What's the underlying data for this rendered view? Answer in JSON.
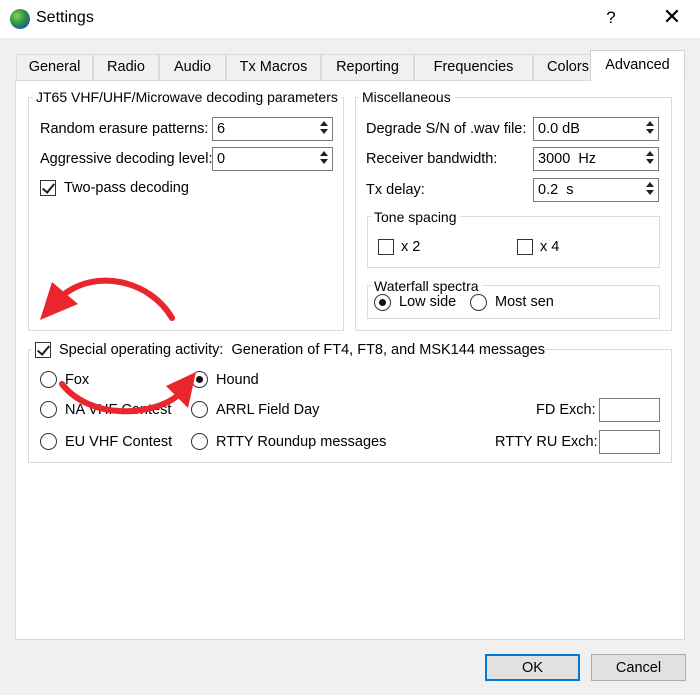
{
  "window": {
    "title": "Settings",
    "help": "?",
    "close": "✕"
  },
  "tabs": [
    {
      "label": "General"
    },
    {
      "label": "Radio"
    },
    {
      "label": "Audio"
    },
    {
      "label": "Tx Macros"
    },
    {
      "label": "Reporting"
    },
    {
      "label": "Frequencies"
    },
    {
      "label": "Colors"
    },
    {
      "label": "Advanced"
    }
  ],
  "jt65": {
    "title": "JT65 VHF/UHF/Microwave decoding parameters",
    "random_erasure": {
      "label": "Random erasure patterns:",
      "value": "6"
    },
    "aggressive": {
      "label": "Aggressive decoding level:",
      "value": "0"
    },
    "two_pass": {
      "label": "Two-pass decoding",
      "checked": true
    }
  },
  "misc": {
    "title": "Miscellaneous",
    "degrade": {
      "label": "Degrade S/N of .wav file:",
      "value": "0.0 dB"
    },
    "rx_bw": {
      "label": "Receiver bandwidth:",
      "value": "3000  Hz"
    },
    "tx_delay": {
      "label": "Tx delay:",
      "value": "0.2  s"
    },
    "tone_spacing": {
      "title": "Tone spacing",
      "x2": "x 2",
      "x4": "x 4"
    },
    "waterfall": {
      "title": "Waterfall spectra",
      "low_side": "Low side",
      "most_sen": "Most sen"
    }
  },
  "special": {
    "label": "Special operating activity:  Generation of FT4, FT8, and MSK144 messages",
    "checked": true,
    "options": {
      "fox": "Fox",
      "hound": "Hound",
      "na_vhf": "NA VHF Contest",
      "arrl_fd": "ARRL Field Day",
      "eu_vhf": "EU VHF Contest",
      "rtty": "RTTY Roundup messages"
    },
    "selected": "Hound",
    "fd_exch": {
      "label": "FD Exch:",
      "value": ""
    },
    "rtty_exch": {
      "label": "RTTY RU Exch:",
      "value": ""
    }
  },
  "buttons": {
    "ok": "OK",
    "cancel": "Cancel"
  },
  "colors": {
    "annotation_arrow": "#e8262b",
    "focus_blue": "#0078d7"
  }
}
